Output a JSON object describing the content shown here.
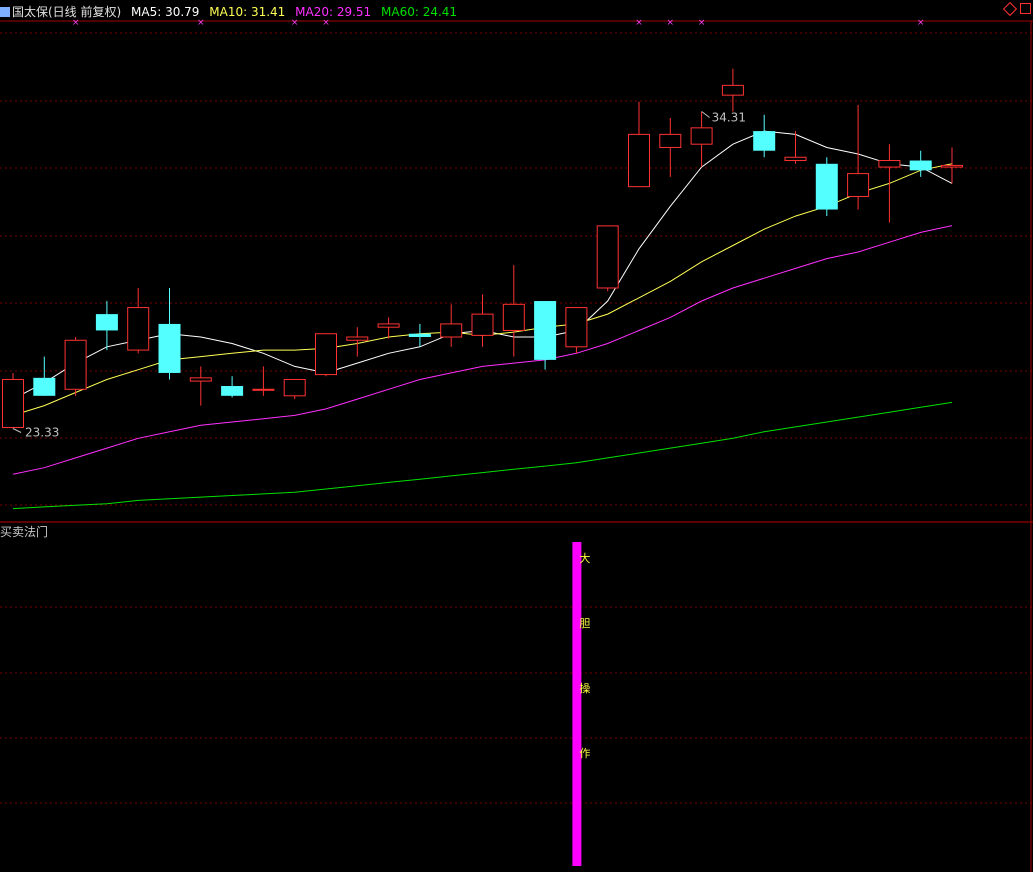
{
  "header": {
    "title": "国太保(日线 前复权)",
    "ma5_label": "MA5: 30.79",
    "ma10_label": "MA10: 31.41",
    "ma20_label": "MA20: 29.51",
    "ma60_label": "MA60: 24.41"
  },
  "colors": {
    "background": "#000000",
    "grid": "#7a0000",
    "up": "#ff3232",
    "down": "#54ffff",
    "ma5": "#ffffff",
    "ma10": "#ffff54",
    "ma20": "#ff30ff",
    "ma60": "#00e000",
    "signal_bar": "#ff00ff",
    "signal_text": "#ffff40"
  },
  "indicator_panel": {
    "title": "买卖法门",
    "signal_chars": [
      "大",
      "胆",
      "操",
      "作"
    ]
  },
  "chart_data": {
    "type": "candlestick",
    "price_min_label": "23.33",
    "price_max_label": "34.31",
    "ylim": [
      20.5,
      35.8
    ],
    "candles": [
      {
        "o": 23.33,
        "h": 25.0,
        "l": 23.3,
        "c": 24.8
      },
      {
        "o": 24.85,
        "h": 25.5,
        "l": 24.3,
        "c": 24.3
      },
      {
        "o": 24.5,
        "h": 26.1,
        "l": 24.3,
        "c": 26.0
      },
      {
        "o": 26.8,
        "h": 27.2,
        "l": 25.7,
        "c": 26.3
      },
      {
        "o": 25.7,
        "h": 27.6,
        "l": 25.6,
        "c": 27.0
      },
      {
        "o": 26.5,
        "h": 27.6,
        "l": 24.8,
        "c": 25.0
      },
      {
        "o": 24.75,
        "h": 25.2,
        "l": 24.0,
        "c": 24.85
      },
      {
        "o": 24.6,
        "h": 24.9,
        "l": 24.25,
        "c": 24.3
      },
      {
        "o": 24.5,
        "h": 25.2,
        "l": 24.3,
        "c": 24.5
      },
      {
        "o": 24.3,
        "h": 24.8,
        "l": 24.2,
        "c": 24.8
      },
      {
        "o": 24.95,
        "h": 26.1,
        "l": 24.9,
        "c": 26.2
      },
      {
        "o": 26.0,
        "h": 26.4,
        "l": 25.5,
        "c": 26.1
      },
      {
        "o": 26.4,
        "h": 26.7,
        "l": 26.05,
        "c": 26.5
      },
      {
        "o": 26.2,
        "h": 26.5,
        "l": 25.8,
        "c": 26.1
      },
      {
        "o": 26.1,
        "h": 27.1,
        "l": 25.8,
        "c": 26.5
      },
      {
        "o": 26.15,
        "h": 27.4,
        "l": 25.8,
        "c": 26.8
      },
      {
        "o": 26.3,
        "h": 28.3,
        "l": 25.5,
        "c": 27.1
      },
      {
        "o": 27.2,
        "h": 27.2,
        "l": 25.1,
        "c": 25.4
      },
      {
        "o": 25.8,
        "h": 27.0,
        "l": 25.6,
        "c": 27.0
      },
      {
        "o": 27.6,
        "h": 29.0,
        "l": 27.5,
        "c": 29.5
      },
      {
        "o": 30.7,
        "h": 33.3,
        "l": 30.7,
        "c": 32.3
      },
      {
        "o": 31.9,
        "h": 32.8,
        "l": 31.0,
        "c": 32.3
      },
      {
        "o": 32.0,
        "h": 33.0,
        "l": 31.3,
        "c": 32.5
      },
      {
        "o": 33.5,
        "h": 34.31,
        "l": 33.0,
        "c": 33.8
      },
      {
        "o": 32.4,
        "h": 32.9,
        "l": 31.6,
        "c": 31.8
      },
      {
        "o": 31.5,
        "h": 32.4,
        "l": 31.4,
        "c": 31.6
      },
      {
        "o": 31.4,
        "h": 31.6,
        "l": 29.8,
        "c": 30.0
      },
      {
        "o": 30.4,
        "h": 33.2,
        "l": 30.0,
        "c": 31.1
      },
      {
        "o": 31.3,
        "h": 32.0,
        "l": 29.6,
        "c": 31.5
      },
      {
        "o": 31.5,
        "h": 31.8,
        "l": 31.0,
        "c": 31.2
      },
      {
        "o": 31.3,
        "h": 31.9,
        "l": 30.8,
        "c": 31.35
      }
    ],
    "series": [
      {
        "name": "MA5",
        "values": [
          24.2,
          24.7,
          25.3,
          25.8,
          26.0,
          26.2,
          26.1,
          25.9,
          25.6,
          25.2,
          25.0,
          25.3,
          25.6,
          25.8,
          26.2,
          26.3,
          26.1,
          26.1,
          26.3,
          27.2,
          28.8,
          30.1,
          31.3,
          32.0,
          32.4,
          32.3,
          31.9,
          31.7,
          31.4,
          31.3,
          30.8
        ]
      },
      {
        "name": "MA10",
        "values": [
          23.7,
          24.0,
          24.4,
          24.8,
          25.1,
          25.4,
          25.5,
          25.6,
          25.7,
          25.7,
          25.75,
          25.9,
          26.1,
          26.2,
          26.25,
          26.15,
          26.25,
          26.4,
          26.5,
          26.8,
          27.3,
          27.8,
          28.4,
          28.9,
          29.4,
          29.8,
          30.1,
          30.5,
          30.8,
          31.2,
          31.4
        ]
      },
      {
        "name": "MA20",
        "values": [
          21.9,
          22.1,
          22.4,
          22.7,
          23.0,
          23.2,
          23.4,
          23.5,
          23.6,
          23.7,
          23.9,
          24.2,
          24.5,
          24.8,
          25.0,
          25.2,
          25.3,
          25.4,
          25.6,
          25.9,
          26.3,
          26.7,
          27.2,
          27.6,
          27.9,
          28.2,
          28.5,
          28.7,
          29.0,
          29.3,
          29.51
        ]
      },
      {
        "name": "MA60",
        "values": [
          20.85,
          20.9,
          20.95,
          21.0,
          21.1,
          21.15,
          21.2,
          21.25,
          21.3,
          21.35,
          21.45,
          21.55,
          21.65,
          21.75,
          21.85,
          21.95,
          22.05,
          22.15,
          22.25,
          22.4,
          22.55,
          22.7,
          22.85,
          23.0,
          23.2,
          23.35,
          23.5,
          23.65,
          23.8,
          23.95,
          24.1
        ]
      }
    ],
    "signal_index": 18
  }
}
